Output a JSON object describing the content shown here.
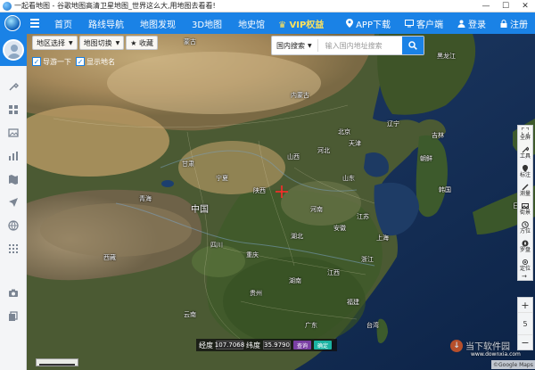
{
  "window": {
    "title": "一起看地图 - 谷歌地图高清卫星地图_世界这么大,用地图去看看!",
    "controls": [
      "minimize",
      "maximize",
      "close"
    ]
  },
  "navbar": {
    "items": [
      "首页",
      "路线导航",
      "地图发现",
      "3D地图",
      "地史馆"
    ],
    "vip_label": "VIP权益",
    "app_download": "APP下载",
    "client": "客户端",
    "login": "登录",
    "register": "注册"
  },
  "map_controls": {
    "region_select": "地区选择",
    "map_switch": "地图切换",
    "favorite": "★ 收藏",
    "checkbox_1": "导游一下",
    "checkbox_2": "显示地名"
  },
  "search": {
    "scope": "国内搜索",
    "placeholder": "输入国内地址搜索"
  },
  "right_tools": {
    "fullscreen": "全屏",
    "tools": "工具",
    "mark": "标注",
    "measure": "测量",
    "pano": "街景",
    "direction": "方位",
    "compass": "罗盘",
    "locate": "定位"
  },
  "zoom": {
    "level": "5",
    "in": "+",
    "out": "−"
  },
  "coord": {
    "lng_label": "经度",
    "lng_value": "107.7068",
    "lat_label": "纬度",
    "lat_value": "35.9790",
    "query_btn": "查询",
    "locate_btn": "确定"
  },
  "map_labels": {
    "mongolia": "蒙古",
    "china": "中国",
    "beijing": "北京",
    "shanxi": "山西",
    "shaanxi": "陕西",
    "shandong": "山东",
    "henan": "河南",
    "liaoning": "辽宁",
    "hebei": "河北",
    "korea": "韩国",
    "nk": "朝鲜",
    "japan": "日本",
    "shanghai": "上海",
    "hubei": "湖北",
    "sichuan": "四川",
    "taiwan": "台湾",
    "jilin": "吉林",
    "guangdong": "广东",
    "neimeng": "内蒙古",
    "ningxia": "宁夏",
    "xizang": "西藏",
    "zhejiang": "浙江",
    "gansu": "甘肃",
    "qinghai": "青海",
    "anhui": "安徽",
    "hunan": "湖南",
    "jiangxi": "江西",
    "fujian": "福建",
    "guizhou": "贵州",
    "yunnan": "云南",
    "chongqing": "重庆",
    "tianjin": "天津",
    "jiangsu": "江苏",
    "heilongjiang": "黑龙江"
  },
  "footer": {
    "google": "©Google Maps",
    "watermark": "当下软件园",
    "watermark_url": "www.downxia.com"
  },
  "colors": {
    "brand_blue": "#1a82e6",
    "vip_yellow": "#ffe35b",
    "query_purple": "#7a3fa4",
    "locate_teal": "#1bb3a2"
  }
}
